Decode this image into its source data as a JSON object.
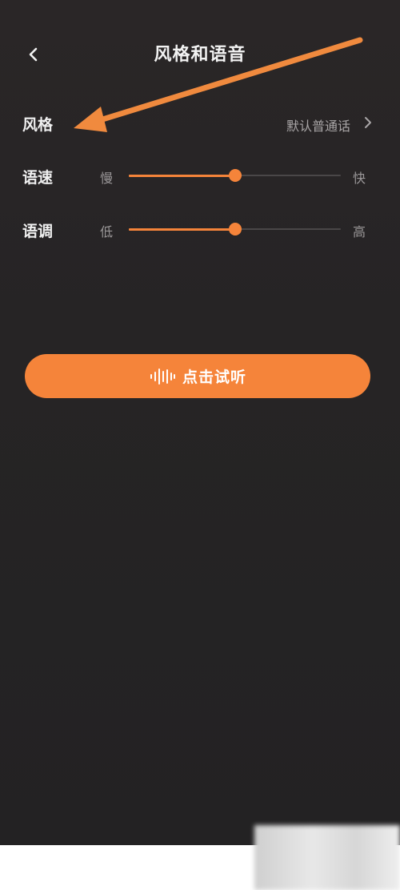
{
  "header": {
    "title": "风格和语音",
    "back_icon": "chevron-left-icon"
  },
  "style_row": {
    "label": "风格",
    "value": "默认普通话",
    "chevron_icon": "chevron-right-icon"
  },
  "speed_row": {
    "label": "语速",
    "min_label": "慢",
    "max_label": "快",
    "level": 0.5
  },
  "tone_row": {
    "label": "语调",
    "min_label": "低",
    "max_label": "高",
    "level": 0.5
  },
  "listen_button": {
    "label": "点击试听",
    "icon": "sound-wave-icon"
  },
  "colors": {
    "accent": "#f5843a",
    "background": "#262425",
    "text": "#f0f0f0",
    "muted_text": "#a9a6a7"
  }
}
